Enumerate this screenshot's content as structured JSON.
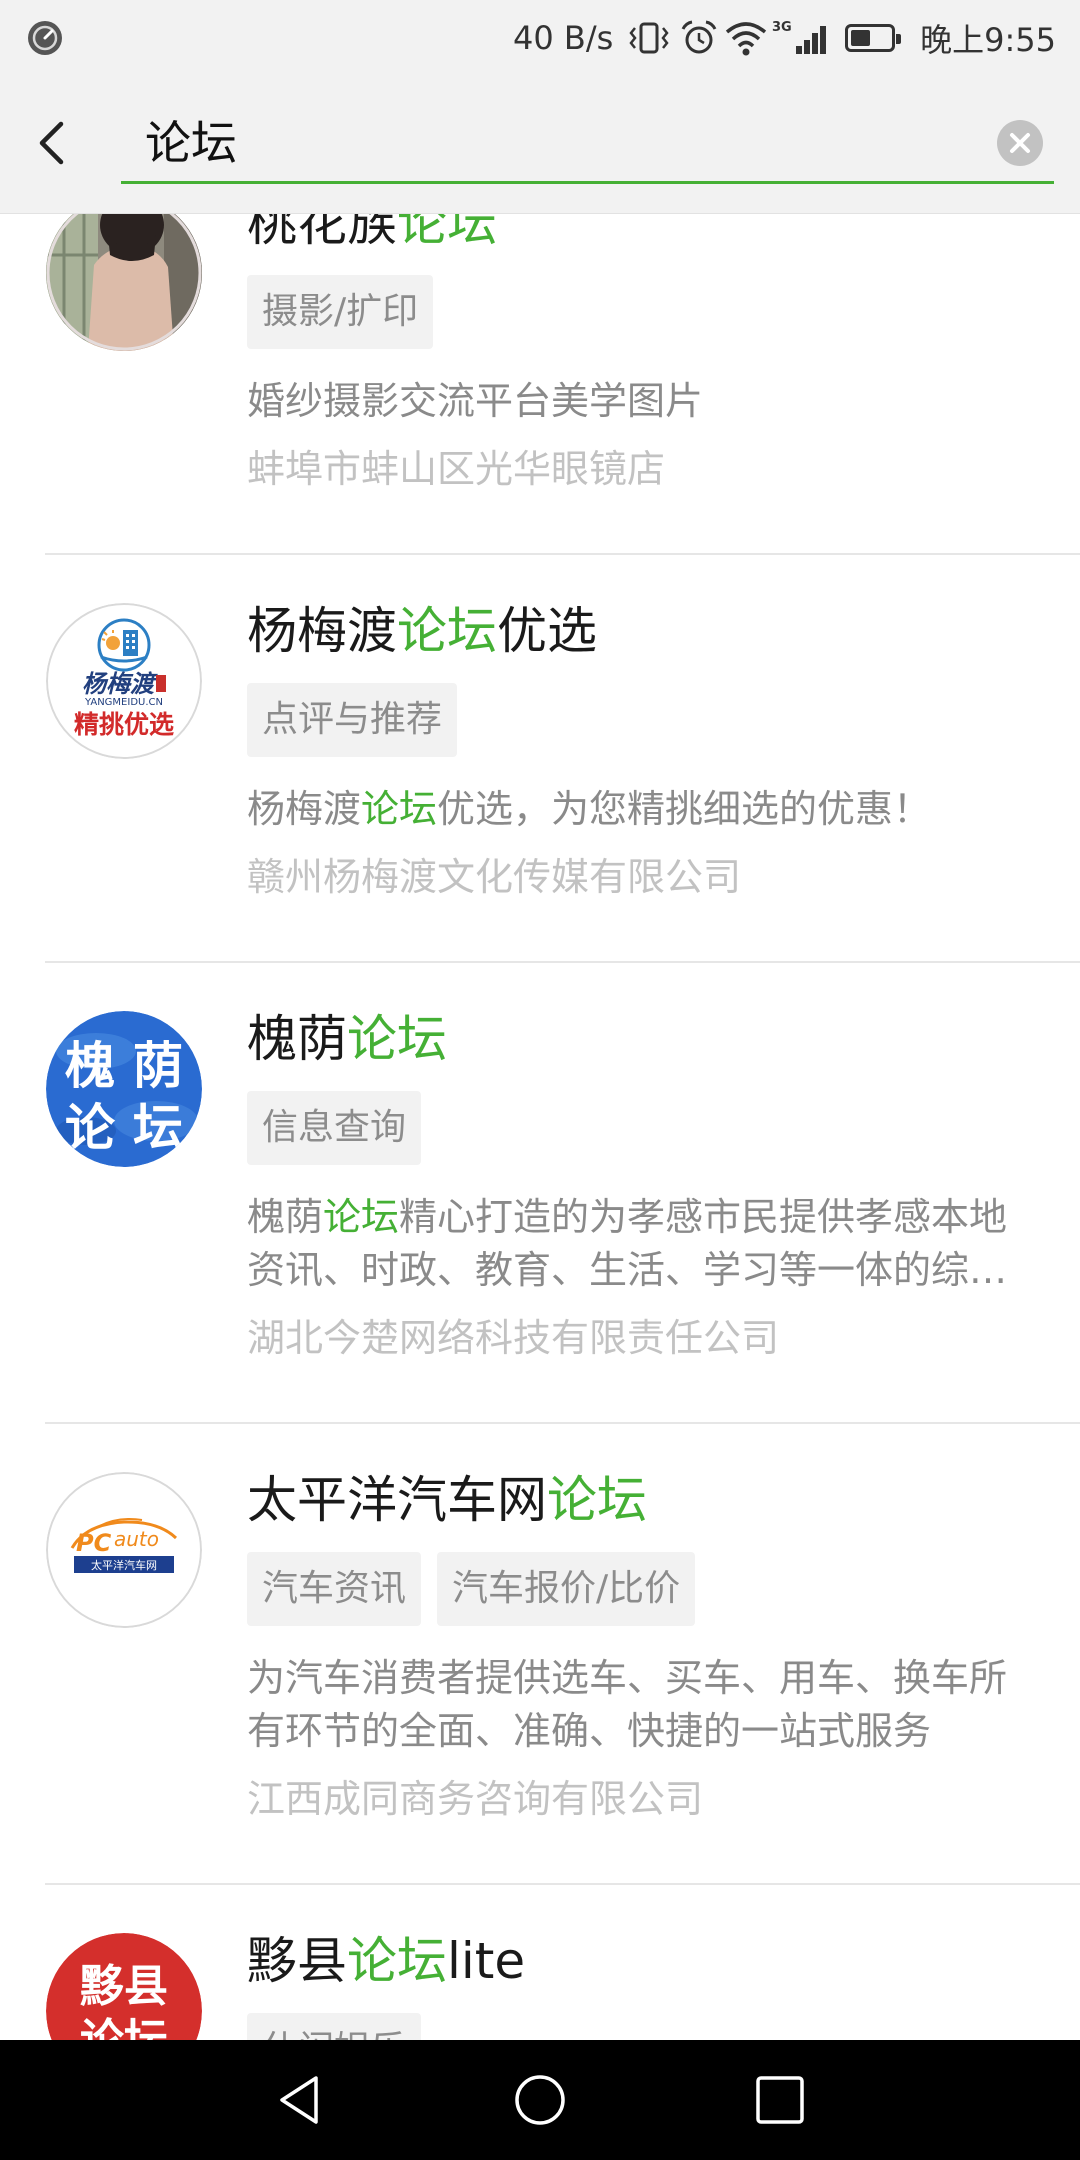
{
  "theme": {
    "accent": "#45b035",
    "tag_background": "#f2f2f2",
    "navbar_background": "#000000"
  },
  "status_bar": {
    "left_icon": "clock-icon",
    "network_speed": "40 B/s",
    "network_type": "3G",
    "time": "晚上9:55",
    "battery_level": 0.5,
    "icons": [
      "vibrate-icon",
      "alarm-icon",
      "wifi-icon",
      "signal-icon",
      "battery-icon"
    ]
  },
  "search": {
    "query": "论坛",
    "back_icon": "chevron-left-icon",
    "clear_icon": "clear-icon"
  },
  "results": [
    {
      "title": [
        {
          "text": "桃花族",
          "hl": false
        },
        {
          "text": "论坛",
          "hl": true
        }
      ],
      "tags": [
        "摄影/扩印"
      ],
      "desc": [
        {
          "text": "婚纱摄影交流平台美学图片",
          "hl": false
        }
      ],
      "company": "蚌埠市蚌山区光华眼镜店",
      "avatar": {
        "type": "photo"
      }
    },
    {
      "title": [
        {
          "text": "杨梅渡",
          "hl": false
        },
        {
          "text": "论坛",
          "hl": true
        },
        {
          "text": "优选",
          "hl": false
        }
      ],
      "tags": [
        "点评与推荐"
      ],
      "desc": [
        {
          "text": "杨梅渡",
          "hl": false
        },
        {
          "text": "论坛",
          "hl": true
        },
        {
          "text": "优选，为您精挑细选的优惠！",
          "hl": false
        }
      ],
      "company": "赣州杨梅渡文化传媒有限公司",
      "avatar": {
        "type": "logo",
        "lines": [
          "杨梅渡",
          "YANGMEIDU.CN",
          "精挑优选"
        ]
      }
    },
    {
      "title": [
        {
          "text": "槐荫",
          "hl": false
        },
        {
          "text": "论坛",
          "hl": true
        }
      ],
      "tags": [
        "信息查询"
      ],
      "desc": [
        {
          "text": "槐荫",
          "hl": false
        },
        {
          "text": "论坛",
          "hl": true
        },
        {
          "text": "精心打造的为孝感市民提供孝感本地资讯、时政、教育、生活、学习等一体的综…",
          "hl": false
        }
      ],
      "company": "湖北今楚网络科技有限责任公司",
      "avatar": {
        "type": "logo",
        "lines": [
          "槐",
          "荫",
          "论",
          "坛"
        ]
      }
    },
    {
      "title": [
        {
          "text": "太平洋汽车网",
          "hl": false
        },
        {
          "text": "论坛",
          "hl": true
        }
      ],
      "tags": [
        "汽车资讯",
        "汽车报价/比价"
      ],
      "desc": [
        {
          "text": "为汽车消费者提供选车、买车、用车、换车所有环节的全面、准确、快捷的一站式服务",
          "hl": false
        }
      ],
      "company": "江西成同商务咨询有限公司",
      "avatar": {
        "type": "logo",
        "lines": [
          "PC",
          "auto",
          "太平洋汽车网"
        ]
      }
    },
    {
      "title": [
        {
          "text": "黟县",
          "hl": false
        },
        {
          "text": "论坛",
          "hl": true
        },
        {
          "text": "lite",
          "hl": false
        }
      ],
      "tags": [
        "休闲娱乐"
      ],
      "avatar": {
        "type": "logo",
        "lines": [
          "黟县",
          "论坛"
        ]
      }
    }
  ],
  "nav_bar": {
    "icons": [
      "back-triangle-icon",
      "home-circle-icon",
      "recents-square-icon"
    ]
  }
}
